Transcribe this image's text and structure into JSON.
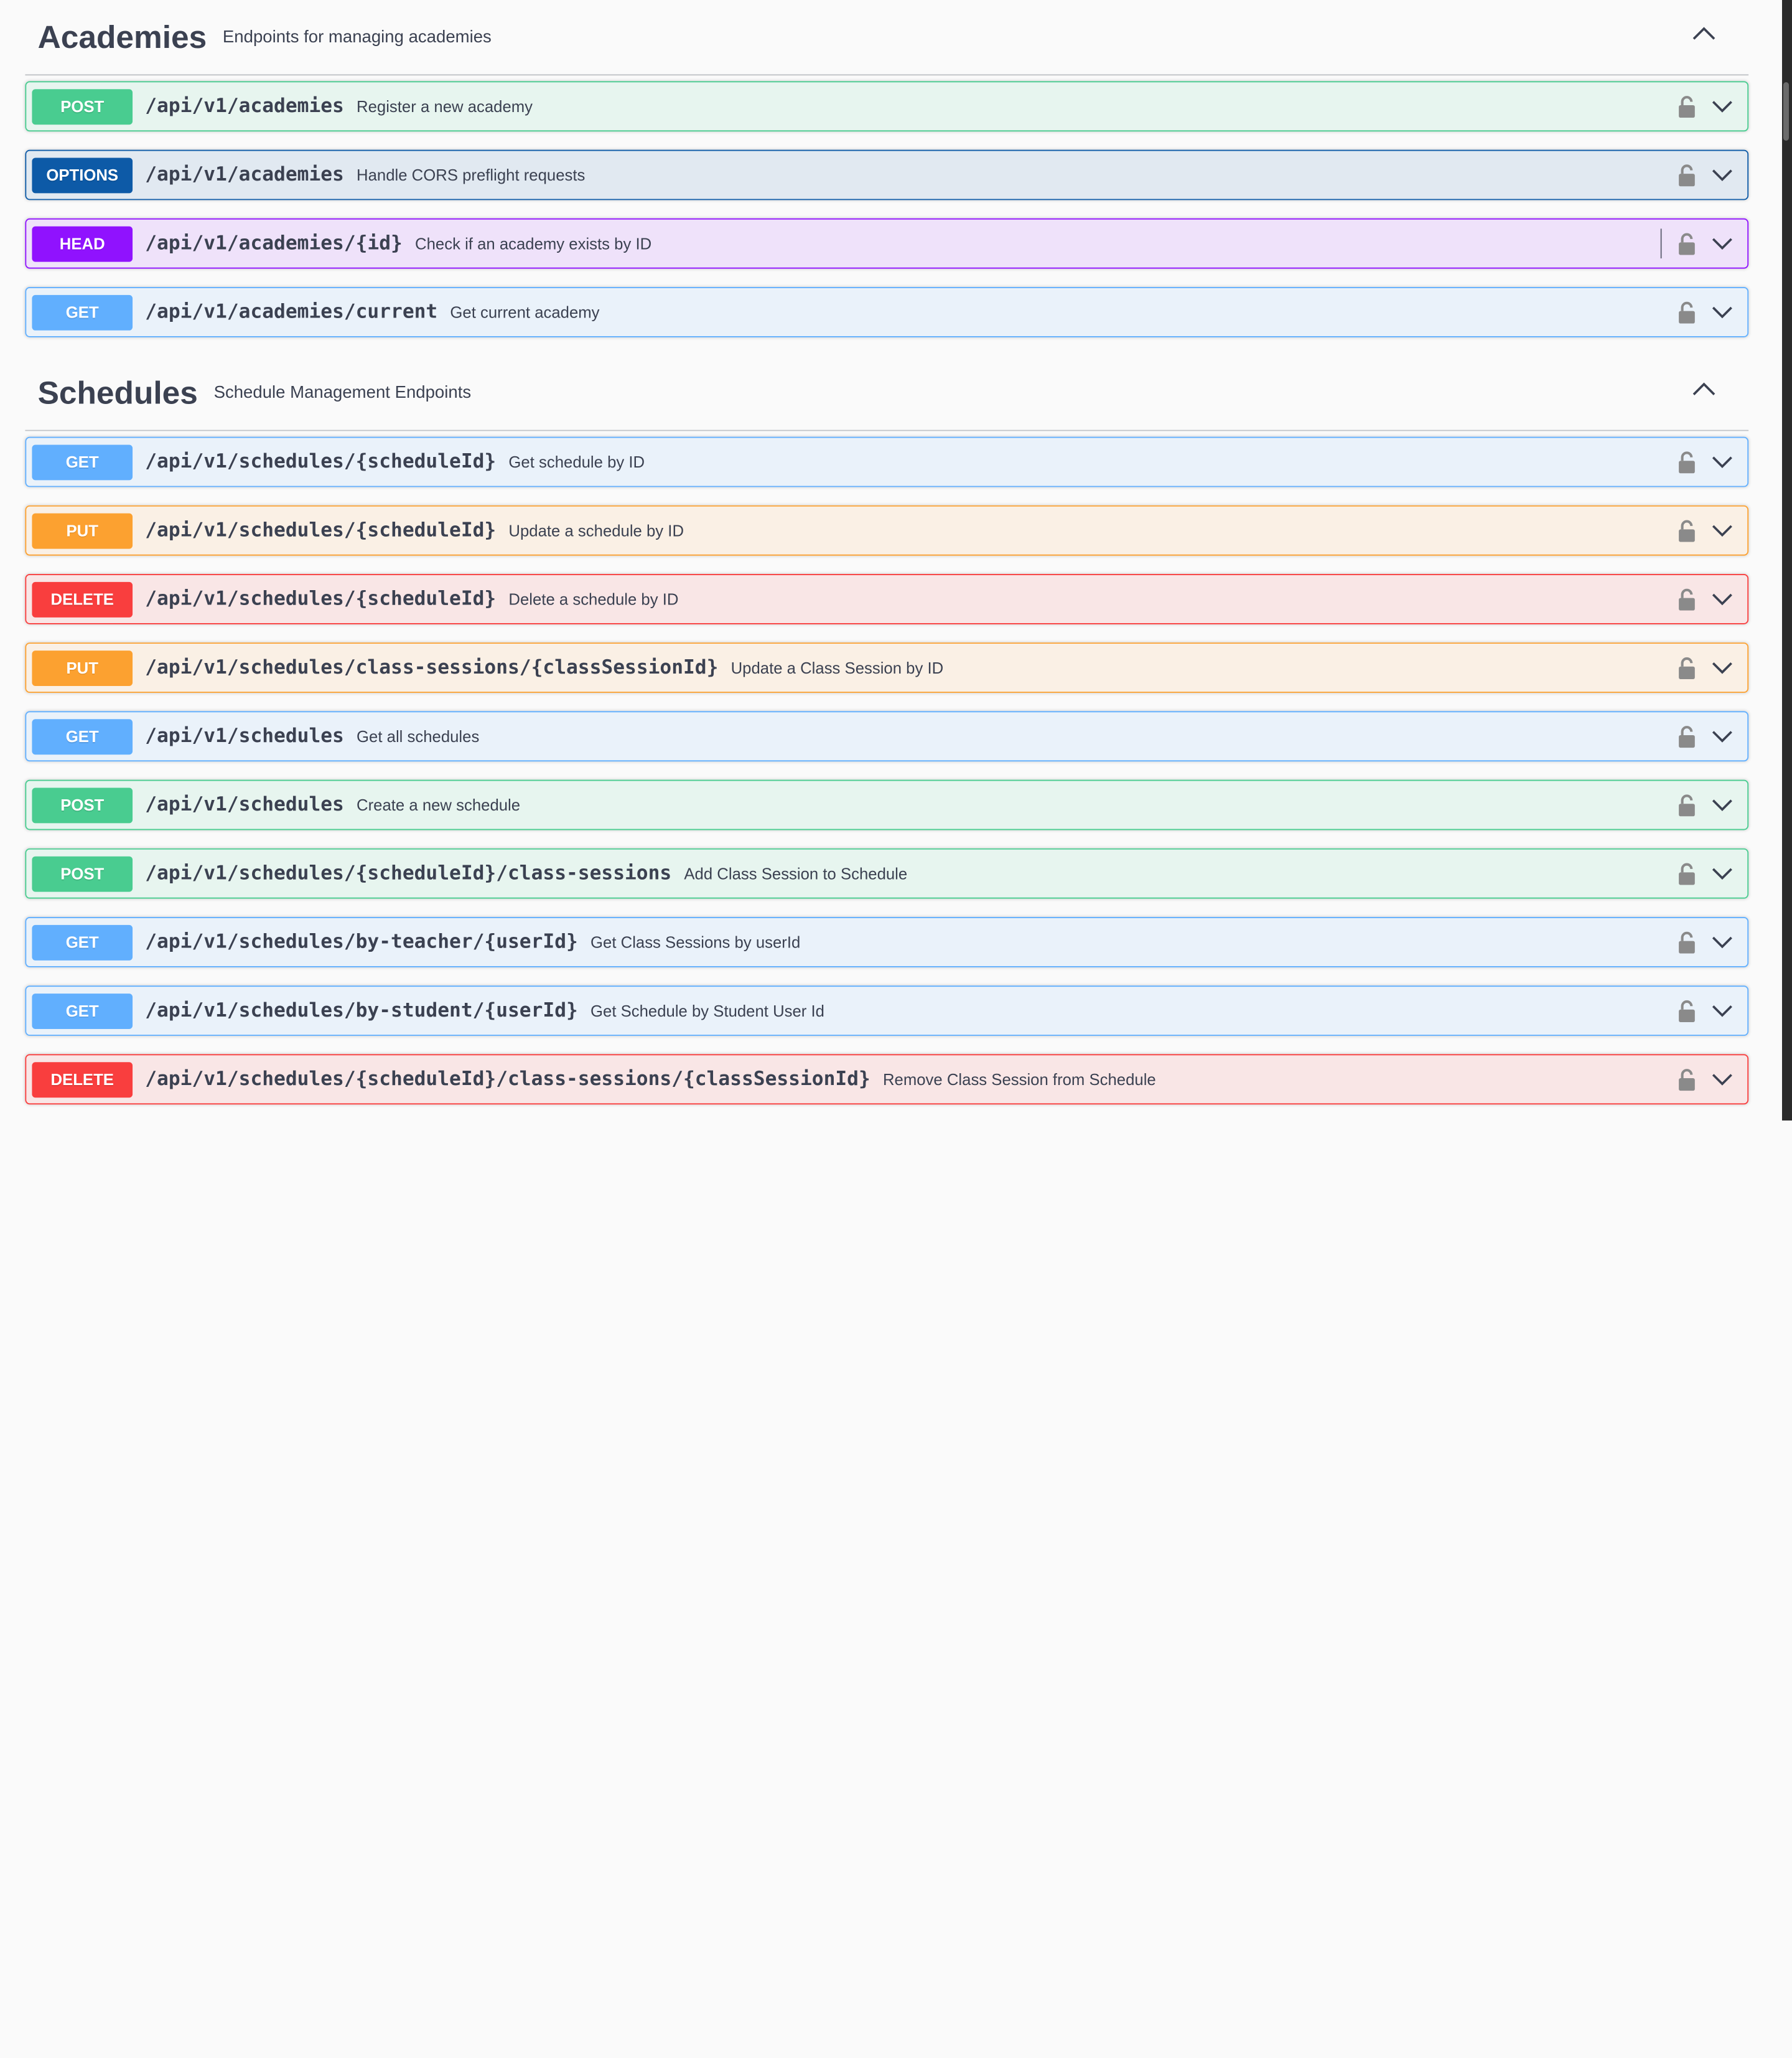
{
  "sections": [
    {
      "name": "Academies",
      "description": "Endpoints for managing academies",
      "toggle_icon": "chevron-up-icon",
      "operations": [
        {
          "method": "POST",
          "kind": "post",
          "path": "/api/v1/academies",
          "summary": "Register a new academy"
        },
        {
          "method": "OPTIONS",
          "kind": "options",
          "path": "/api/v1/academies",
          "summary": "Handle CORS preflight requests"
        },
        {
          "method": "HEAD",
          "kind": "head",
          "path": "/api/v1/academies/{id}",
          "summary": "Check if an academy exists by ID"
        },
        {
          "method": "GET",
          "kind": "get",
          "path": "/api/v1/academies/current",
          "summary": "Get current academy"
        }
      ]
    },
    {
      "name": "Schedules",
      "description": "Schedule Management Endpoints",
      "toggle_icon": "chevron-up-icon",
      "operations": [
        {
          "method": "GET",
          "kind": "get",
          "path": "/api/v1/schedules/{scheduleId}",
          "summary": "Get schedule by ID"
        },
        {
          "method": "PUT",
          "kind": "put",
          "path": "/api/v1/schedules/{scheduleId}",
          "summary": "Update a schedule by ID"
        },
        {
          "method": "DELETE",
          "kind": "delete",
          "path": "/api/v1/schedules/{scheduleId}",
          "summary": "Delete a schedule by ID"
        },
        {
          "method": "PUT",
          "kind": "put",
          "path": "/api/v1/schedules/class-sessions/{classSessionId}",
          "summary": "Update a Class Session by ID"
        },
        {
          "method": "GET",
          "kind": "get",
          "path": "/api/v1/schedules",
          "summary": "Get all schedules"
        },
        {
          "method": "POST",
          "kind": "post",
          "path": "/api/v1/schedules",
          "summary": "Create a new schedule"
        },
        {
          "method": "POST",
          "kind": "post",
          "path": "/api/v1/schedules/{scheduleId}/class-sessions",
          "summary": "Add Class Session to Schedule"
        },
        {
          "method": "GET",
          "kind": "get",
          "path": "/api/v1/schedules/by-teacher/{userId}",
          "summary": "Get Class Sessions by userId"
        },
        {
          "method": "GET",
          "kind": "get",
          "path": "/api/v1/schedules/by-student/{userId}",
          "summary": "Get Schedule by Student User Id"
        },
        {
          "method": "DELETE",
          "kind": "delete",
          "path": "/api/v1/schedules/{scheduleId}/class-sessions/{classSessionId}",
          "summary": "Remove Class Session from Schedule"
        }
      ]
    }
  ],
  "icons": {
    "lock": "lock-icon",
    "expand": "chevron-down-icon"
  },
  "colors": {
    "post": "#49cc90",
    "get": "#61affe",
    "put": "#fca130",
    "delete": "#f93e3e",
    "options": "#0d5aa7",
    "head": "#9012fe",
    "text": "#3b4151"
  }
}
